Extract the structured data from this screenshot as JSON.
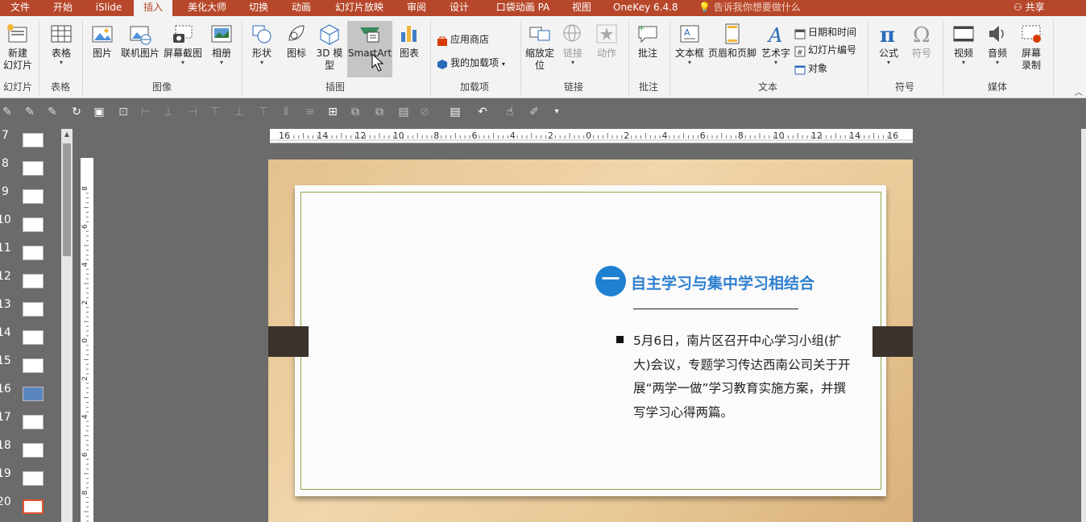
{
  "menu": {
    "tabs": [
      "文件",
      "开始",
      "iSlide",
      "插入",
      "美化大师",
      "切换",
      "动画",
      "幻灯片放映",
      "审阅",
      "设计",
      "口袋动画 PA",
      "视图",
      "OneKey 6.4.8"
    ],
    "active": "插入",
    "tell_me": "告诉我你想要做什么",
    "share": "共享"
  },
  "ribbon": {
    "groups": [
      "幻灯片",
      "表格",
      "图像",
      "插图",
      "加载项",
      "链接",
      "批注",
      "文本",
      "符号",
      "媒体"
    ],
    "buttons": {
      "new_slide": "新建\n幻灯片",
      "table": "表格",
      "picture": "图片",
      "online_picture": "联机图片",
      "screenshot": "屏幕截图",
      "album": "相册",
      "shapes": "形状",
      "icons": "图标",
      "model3d": "3D 模\n型",
      "smartart": "SmartArt",
      "chart": "图表",
      "app_store": "应用商店",
      "my_addins": "我的加载项",
      "zoom": "缩放定\n位",
      "link": "链接",
      "action": "动作",
      "comment": "批注",
      "textbox": "文本框",
      "header_footer": "页眉和页脚",
      "wordart": "艺术字",
      "date_time": "日期和时间",
      "slide_number": "幻灯片编号",
      "object": "对象",
      "equation": "公式",
      "symbol": "符号",
      "video": "视频",
      "audio": "音频",
      "screen_record": "屏幕\n录制"
    }
  },
  "thumbs": [
    "7",
    "8",
    "9",
    "10",
    "11",
    "12",
    "13",
    "14",
    "15",
    "16",
    "17",
    "18",
    "19",
    "20"
  ],
  "selected_thumb": "20",
  "ruler": {
    "h_ticks": [
      "16",
      "14",
      "12",
      "10",
      "8",
      "6",
      "4",
      "2",
      "0",
      "2",
      "4",
      "6",
      "8",
      "10",
      "12",
      "14",
      "16"
    ],
    "v_ticks": [
      "8",
      "6",
      "4",
      "2",
      "0",
      "2",
      "4",
      "6",
      "8"
    ]
  },
  "slide": {
    "badge": "一",
    "heading": "自主学习与集中学习相结合",
    "body": "5月6日，南片区召开中心学习小组(扩大)会议，专题学习传达西南公司关于开展“两学一做”学习教育实施方案，并撰写学习心得两篇。"
  },
  "colors": {
    "accent": "#b7472a",
    "heading": "#2f7fd0",
    "badge": "#1f7fd1",
    "frame": "#8fa84a"
  }
}
